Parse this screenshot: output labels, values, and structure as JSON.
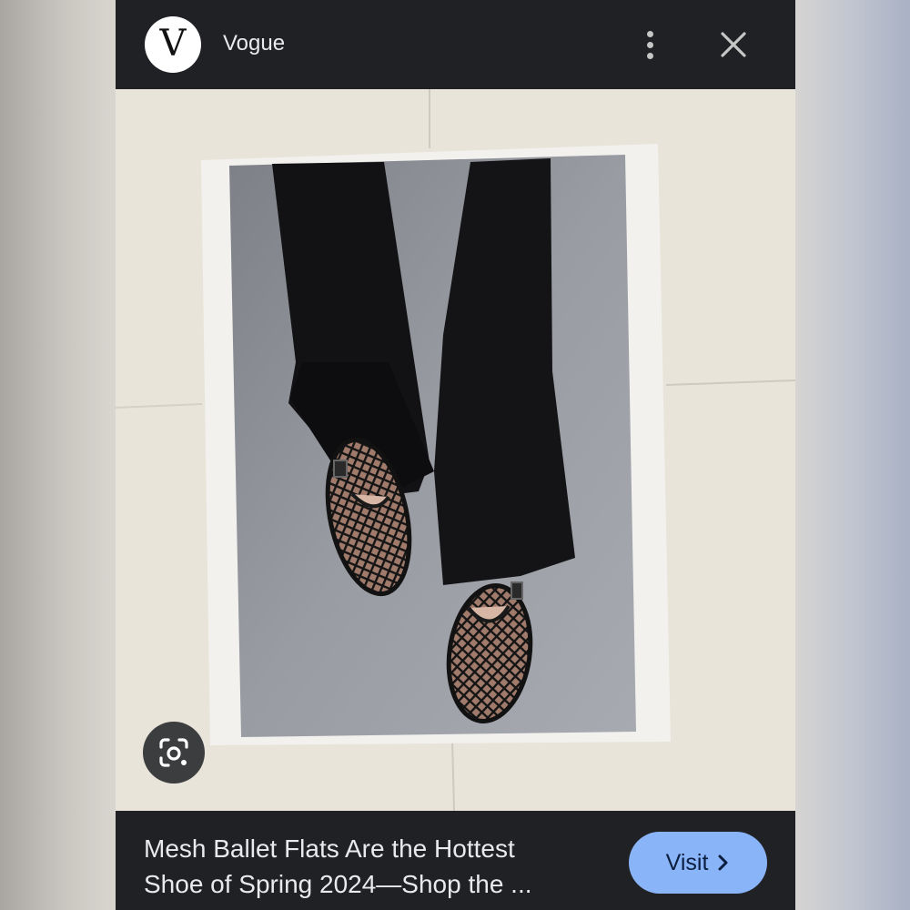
{
  "header": {
    "avatar_letter": "V",
    "site_name": "Vogue",
    "more_icon": "more-vert-icon",
    "close_icon": "close-icon"
  },
  "image": {
    "description_icon": "photo"
  },
  "lens": {
    "icon": "lens-camera-icon"
  },
  "footer": {
    "title_line1": "Mesh Ballet Flats Are the Hottest",
    "title_line2": "Shoe of Spring 2024—Shop the ...",
    "visit_label": "Visit",
    "visit_icon": "chevron-right-icon"
  },
  "colors": {
    "panel_bg": "#202124",
    "accent_button": "#8ab4f8",
    "text_light": "#e8eaed"
  }
}
